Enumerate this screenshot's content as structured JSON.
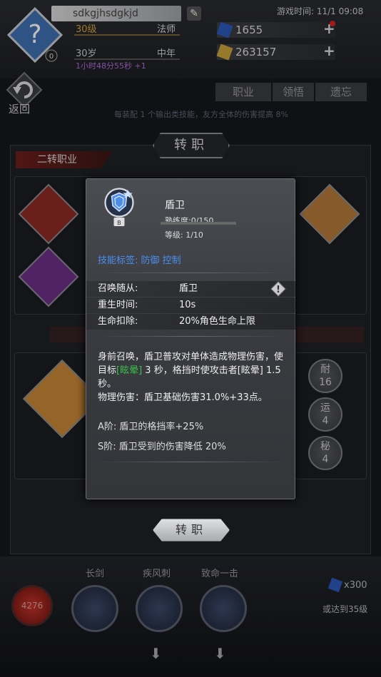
{
  "hud": {
    "player_name": "sdkgjhsdgkjd",
    "level": "30级",
    "class": "法师",
    "age": "30岁",
    "life_stage": "中年",
    "timer": "1小时48分55秒 +1",
    "clock": "游戏时间: 11/1 09:08",
    "avatar_badge": "0",
    "gems": "1655",
    "gold": "263157"
  },
  "background": {
    "back_label": "返回",
    "tabs": [
      "职业",
      "领悟",
      "遗忘"
    ],
    "bonus_line": "每装配 1 个输出类技能，友方全体的伤害提高 8%",
    "panel_title": "转职",
    "second_job_tag": "二转职业",
    "bottom_stats": [
      {
        "label": "耐",
        "value": "16"
      },
      {
        "label": "运",
        "value": "4"
      },
      {
        "label": "秘",
        "value": "4"
      }
    ]
  },
  "bottom_bar": {
    "skill_labels": [
      "长剑",
      "疾风刺",
      "致命一击"
    ],
    "red_orb_value": "4276",
    "gem_cost": "x300",
    "reach_level": "或达到35级"
  },
  "modal": {
    "skill_name": "盾卫",
    "grade": "B",
    "proficiency": "熟练度:0/150",
    "proficiency_fraction": 0,
    "level": "等级: 1/10",
    "tags": "技能标签:  防御  控制",
    "rows": [
      {
        "key": "召唤随从:",
        "value": "盾卫"
      },
      {
        "key": "重生时间:",
        "value": "10s"
      },
      {
        "key": "生命扣除:",
        "value": "20%角色生命上限"
      }
    ],
    "desc_part1": "身前召唤，盾卫普攻对单体造成物理伤害，使目标",
    "desc_stun": "[眩晕]",
    "desc_part2": " 3 秒，格挡时使攻击者[眩晕] 1.5 秒。",
    "desc_line2": "物理伤害：盾卫基础伤害31.0%+33点。",
    "tier_a": "A阶: 盾卫的格挡率+25%",
    "tier_s": "S阶: 盾卫受到的伤害降低 20%"
  },
  "convert_button": "转职",
  "colors": {
    "accent_gold": "#d6a43b",
    "tag_blue": "#4c8ef0",
    "stun_green": "#38c24a",
    "timer_purple": "#b36bd6"
  }
}
